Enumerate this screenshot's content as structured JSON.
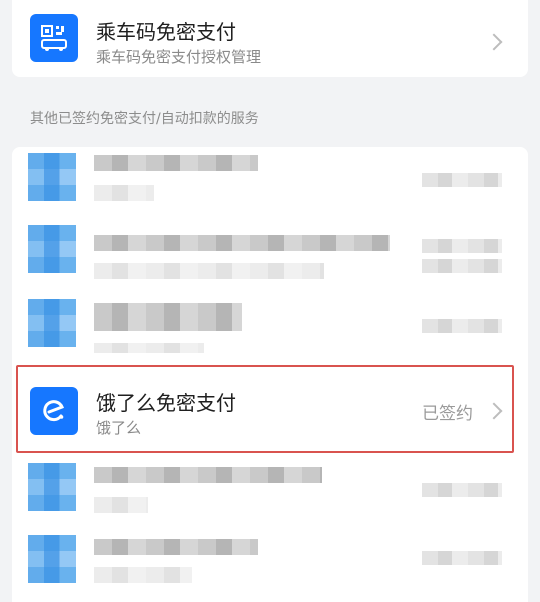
{
  "bus_code_service": {
    "title": "乘车码免密支付",
    "subtitle": "乘车码免密支付授权管理",
    "icon": "bus-qr-code-icon"
  },
  "section": {
    "label": "其他已签约免密支付/自动扣款的服务"
  },
  "highlighted_service": {
    "title": "饿了么免密支付",
    "subtitle": "饿了么",
    "status": "已签约",
    "icon": "eleme-logo-icon"
  },
  "colors": {
    "accent": "#1677ff",
    "highlight_border": "#d9534f",
    "background": "#f2f3f5"
  }
}
